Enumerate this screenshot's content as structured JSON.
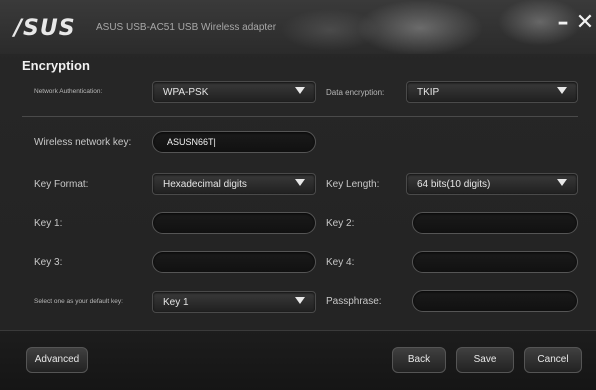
{
  "window": {
    "logo": "/SUS",
    "title": "ASUS USB-AC51 USB Wireless adapter",
    "minimize_glyph": "–",
    "close_glyph": "✕"
  },
  "section_title": "Encryption",
  "network_authentication": {
    "label": "Network Authentication:",
    "value": "WPA-PSK"
  },
  "data_encryption": {
    "label": "Data encryption:",
    "value": "TKIP"
  },
  "wireless_network_key": {
    "label": "Wireless network key:",
    "value": "ASUSN66T|"
  },
  "key_format": {
    "label": "Key Format:",
    "value": "Hexadecimal digits"
  },
  "key_length": {
    "label": "Key Length:",
    "value": "64 bits(10 digits)"
  },
  "keys": {
    "key1_label": "Key 1:",
    "key2_label": "Key 2:",
    "key3_label": "Key 3:",
    "key4_label": "Key 4:",
    "key1_value": "",
    "key2_value": "",
    "key3_value": "",
    "key4_value": ""
  },
  "default_key": {
    "label": "Select one as your default key:",
    "value": "Key 1"
  },
  "passphrase": {
    "label": "Passphrase:",
    "value": ""
  },
  "buttons": {
    "advanced": "Advanced",
    "back": "Back",
    "save": "Save",
    "cancel": "Cancel"
  }
}
